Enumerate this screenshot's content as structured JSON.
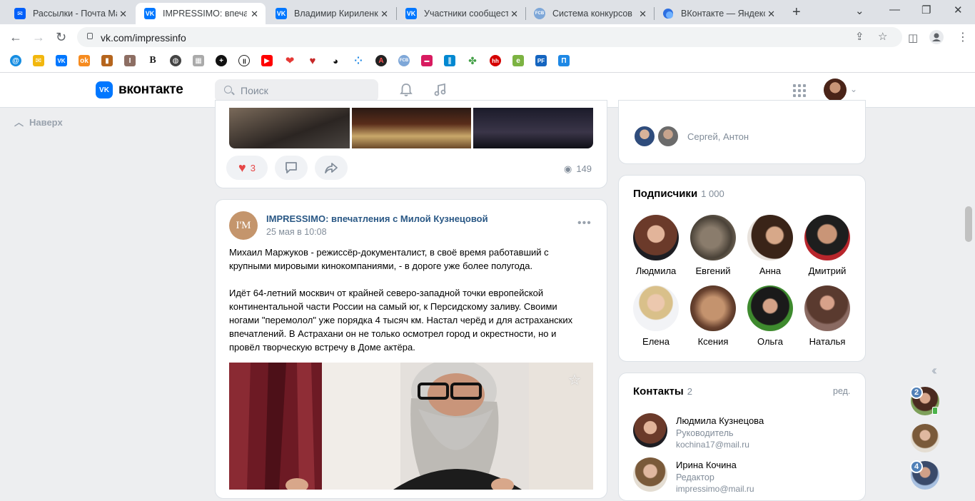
{
  "browser": {
    "tabs": [
      {
        "title": "Рассылки - Почта Ма",
        "favicon": "mail-icon"
      },
      {
        "title": "IMPRESSIMO: впечатл",
        "favicon": "vk-icon"
      },
      {
        "title": "Владимир Кириленк",
        "favicon": "vk-icon"
      },
      {
        "title": "Участники сообщест",
        "favicon": "vk-icon"
      },
      {
        "title": "Система конкурсов",
        "favicon": "fcb-icon"
      },
      {
        "title": "ВКонтакте — Яндекс",
        "favicon": "yandex-browser-icon"
      }
    ],
    "url": "vk.com/impressinfo",
    "bookmark_icons": [
      "mail-ru-icon",
      "gmail-icon",
      "vk-icon",
      "odnoklassniki-icon",
      "bookmark-icon",
      "bookmark-icon",
      "b-icon",
      "globe-icon",
      "bookmark-icon",
      "plus-icon",
      "pause-icon",
      "youtube-icon",
      "heart-icon",
      "heart-icon",
      "panda-icon",
      "dots-icon",
      "afisha-icon",
      "fcb-icon",
      "bookmark-icon",
      "bookmark-icon",
      "bookmark-icon",
      "hh-icon",
      "e-icon",
      "pf-icon",
      "p-icon"
    ]
  },
  "vk": {
    "logo_text": "вконтакте",
    "search_placeholder": "Поиск",
    "up_label": "Наверх",
    "accent": "#0077ff",
    "link_color": "#2a5885"
  },
  "prev_post": {
    "likes": "3",
    "views": "149"
  },
  "post": {
    "avatar_text": "I'M",
    "author": "IMPRESSIMO: впечатления с Милой Кузнецовой",
    "date": "25 мая в 10:08",
    "lines1": [
      "Михаил Маржуков - режиссёр-документалист, в своё время работавший с",
      "крупными мировыми кинокомпаниями, - в дороге уже более полугода."
    ],
    "lines2": [
      "Идёт 64-летний москвич от крайней северо-западной точки европейской",
      "континентальной части России на самый юг, к Персидскому заливу. Своими",
      "ногами \"перемолол\" уже порядка 4 тысяч км. Настал черёд и для астраханских",
      "впечатлений. В Астрахани он не только осмотрел город и окрестности, но и",
      "провёл творческую встречу в Доме актёра."
    ]
  },
  "friends_card": {
    "names": "Сергей, Антон"
  },
  "subscribers": {
    "title": "Подписчики",
    "count": "1 000",
    "people": [
      {
        "name": "Людмила"
      },
      {
        "name": "Евгений"
      },
      {
        "name": "Анна"
      },
      {
        "name": "Дмитрий"
      },
      {
        "name": "Елена"
      },
      {
        "name": "Ксения"
      },
      {
        "name": "Ольга"
      },
      {
        "name": "Наталья"
      }
    ]
  },
  "contacts": {
    "title": "Контакты",
    "count": "2",
    "edit": "ред.",
    "items": [
      {
        "name": "Людмила Кузнецова",
        "role": "Руководитель",
        "email": "kochina17@mail.ru"
      },
      {
        "name": "Ирина Кочина",
        "role": "Редактор",
        "email": "impressimo@mail.ru"
      }
    ]
  },
  "chat_badges": [
    "2",
    "4"
  ]
}
